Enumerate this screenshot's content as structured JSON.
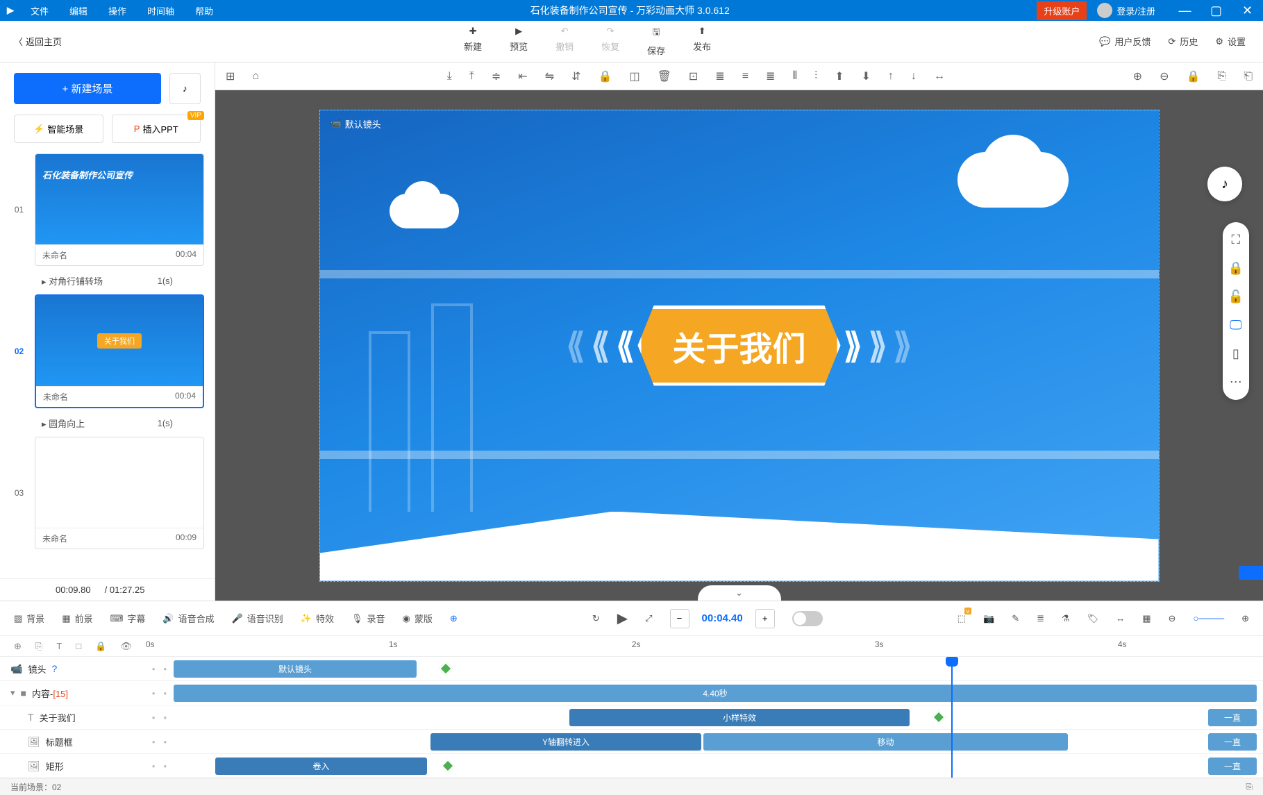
{
  "titlebar": {
    "menus": [
      "文件",
      "编辑",
      "操作",
      "时间轴",
      "帮助"
    ],
    "title": "石化装备制作公司宣传 - 万彩动画大师 3.0.612",
    "upgrade": "升级账户",
    "login": "登录/注册"
  },
  "toolbar": {
    "back": "返回主页",
    "new": "新建",
    "preview": "预览",
    "undo": "撤销",
    "redo": "恢复",
    "save": "保存",
    "publish": "发布",
    "feedback": "用户反馈",
    "history": "历史",
    "settings": "设置"
  },
  "sidebar": {
    "newScene": "+  新建场景",
    "smartScene": "智能场景",
    "insertPPT": "插入PPT",
    "scenes": [
      {
        "num": "01",
        "name": "未命名",
        "time": "00:04",
        "trans": "对角行铺转场",
        "dur": "1(s)"
      },
      {
        "num": "02",
        "name": "未命名",
        "time": "00:04",
        "trans": "圆角向上",
        "dur": "1(s)"
      },
      {
        "num": "03",
        "name": "未命名",
        "time": "00:09"
      }
    ],
    "curTime": "00:09.80",
    "totalTime": "/ 01:27.25"
  },
  "canvas": {
    "camLabel": "默认镜头",
    "title": "关于我们",
    "thumb2Badge": "关于我们"
  },
  "bottomTools": {
    "bg": "背景",
    "fg": "前景",
    "subtitle": "字幕",
    "tts": "语音合成",
    "asr": "语音识别",
    "fx": "特效",
    "record": "录音",
    "mask": "蒙版",
    "time": "00:04.40"
  },
  "ruler": {
    "t0": "0s",
    "t1": "1s",
    "t2": "2s",
    "t3": "3s",
    "t4": "4s"
  },
  "tracks": {
    "camera": "镜头",
    "content": "内容-",
    "contentCount": "[15]",
    "item1": "关于我们",
    "item2": "标题框",
    "item3": "矩形",
    "clip_default": "默认镜头",
    "clip_440": "4.40秒",
    "clip_xiaoyang": "小样特效",
    "clip_yflip": "Y轴翻转进入",
    "clip_move": "移动",
    "clip_roll": "卷入",
    "clip_always": "一直"
  },
  "status": {
    "curScene": "当前场景：02"
  }
}
